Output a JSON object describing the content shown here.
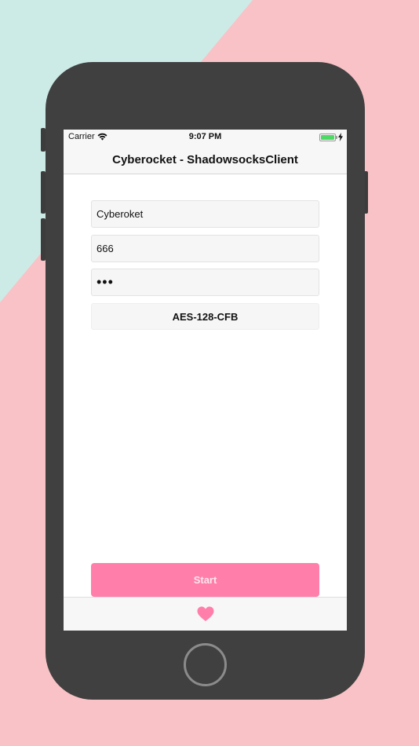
{
  "status_bar": {
    "carrier": "Carrier",
    "time": "9:07 PM",
    "battery_level": 1.0,
    "charging": true
  },
  "nav": {
    "title": "Cyberocket - ShadowsocksClient"
  },
  "form": {
    "server": "Cyberoket",
    "port": "666",
    "password_masked": "•••",
    "method": "AES-128-CFB"
  },
  "actions": {
    "start_label": "Start"
  },
  "tab_bar": {
    "icon": "heart-icon"
  },
  "colors": {
    "accent": "#ff7faa",
    "background_pink": "#f9c2c6",
    "background_mint": "#cdebe6",
    "phone_body": "#404040"
  }
}
